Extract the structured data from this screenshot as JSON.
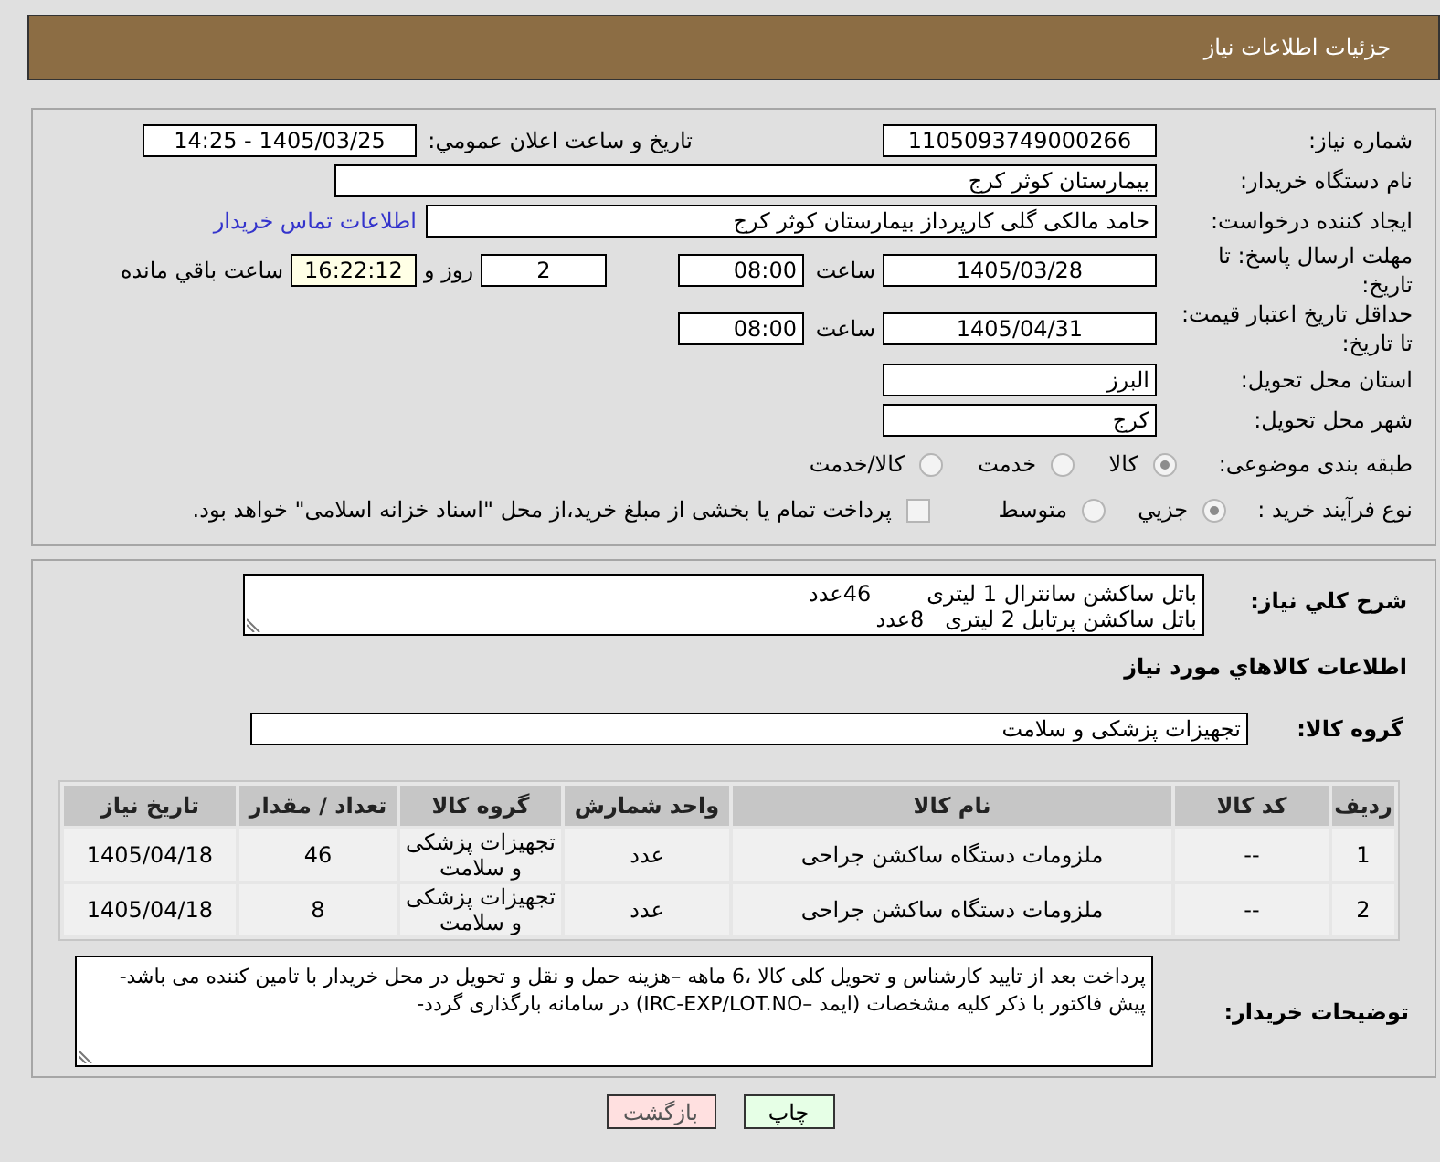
{
  "header": {
    "title": "جزئیات اطلاعات نیاز"
  },
  "details": {
    "need_number": {
      "label": "شماره نیاز:",
      "value": "1105093749000266"
    },
    "announcement": {
      "label": "تاریخ و ساعت اعلان عمومي:",
      "value": "1405/03/25 - 14:25"
    },
    "buyer_org": {
      "label": "نام دستگاه خریدار:",
      "value": "بیمارستان کوثر کرج"
    },
    "requester": {
      "label": "ایجاد کننده درخواست:",
      "value": "حامد مالکی گلی کارپرداز بیمارستان کوثر کرج",
      "contact_link": "اطلاعات تماس خریدار"
    },
    "response_deadline": {
      "label": "مهلت ارسال پاسخ: تا تاریخ:",
      "date": "1405/03/28",
      "time_label": "ساعت",
      "time": "08:00",
      "days": "2",
      "days_label": "روز و",
      "remaining": "16:22:12",
      "remaining_label": "ساعت باقي مانده"
    },
    "price_validity": {
      "label": "حداقل تاریخ اعتبار قیمت: تا تاریخ:",
      "date": "1405/04/31",
      "time_label": "ساعت",
      "time": "08:00"
    },
    "delivery_province": {
      "label": "استان محل تحویل:",
      "value": "البرز"
    },
    "delivery_city": {
      "label": "شهر محل تحویل:",
      "value": "کرج"
    },
    "category": {
      "label": "طبقه بندی موضوعی:",
      "options": [
        {
          "label": "کالا",
          "selected": true
        },
        {
          "label": "خدمت",
          "selected": false
        },
        {
          "label": "کالا/خدمت",
          "selected": false
        }
      ]
    },
    "purchase_process": {
      "label": "نوع فرآیند خرید :",
      "options": [
        {
          "label": "جزيي",
          "selected": true
        },
        {
          "label": "متوسط",
          "selected": false
        }
      ],
      "treasury": {
        "label": "پرداخت تمام یا بخشی از مبلغ خرید،از محل \"اسناد خزانه اسلامی\" خواهد بود.",
        "checked": false
      }
    }
  },
  "summary": {
    "label": "شرح کلي نياز:",
    "lines": [
      "باتل ساکشن سانترال 1 لیتری        46عدد",
      "باتل ساکشن پرتابل 2 لیتری   8عدد"
    ]
  },
  "goods": {
    "title": "اطلاعات کالاهاي مورد نياز",
    "group_label": "گروه کالا:",
    "group_value": "تجهیزات پزشکی و سلامت",
    "table": {
      "columns": [
        "ردیف",
        "کد کالا",
        "نام کالا",
        "واحد شمارش",
        "گروه کالا",
        "تعداد / مقدار",
        "تاریخ نیاز"
      ],
      "rows": [
        [
          "1",
          "--",
          "ملزومات دستگاه ساکشن جراحی",
          "عدد",
          "تجهیزات پزشکی و سلامت",
          "46",
          "1405/04/18"
        ],
        [
          "2",
          "--",
          "ملزومات دستگاه ساکشن جراحی",
          "عدد",
          "تجهیزات پزشکی و سلامت",
          "8",
          "1405/04/18"
        ]
      ]
    }
  },
  "buyer_notes": {
    "label": "توضیحات خریدار:",
    "text": "پرداخت بعد از تایید کارشناس و تحویل کلی کالا ،6 ماهه –هزینه حمل و نقل و تحویل در محل خریدار با تامین کننده می باشد-پیش فاکتور با ذکر کلیه مشخصات (ایمد –IRC-EXP/LOT.NO) در سامانه بارگذاری گردد-"
  },
  "buttons": [
    {
      "kind": "print",
      "label": "چاپ"
    },
    {
      "kind": "back",
      "label": "بازگشت"
    }
  ]
}
